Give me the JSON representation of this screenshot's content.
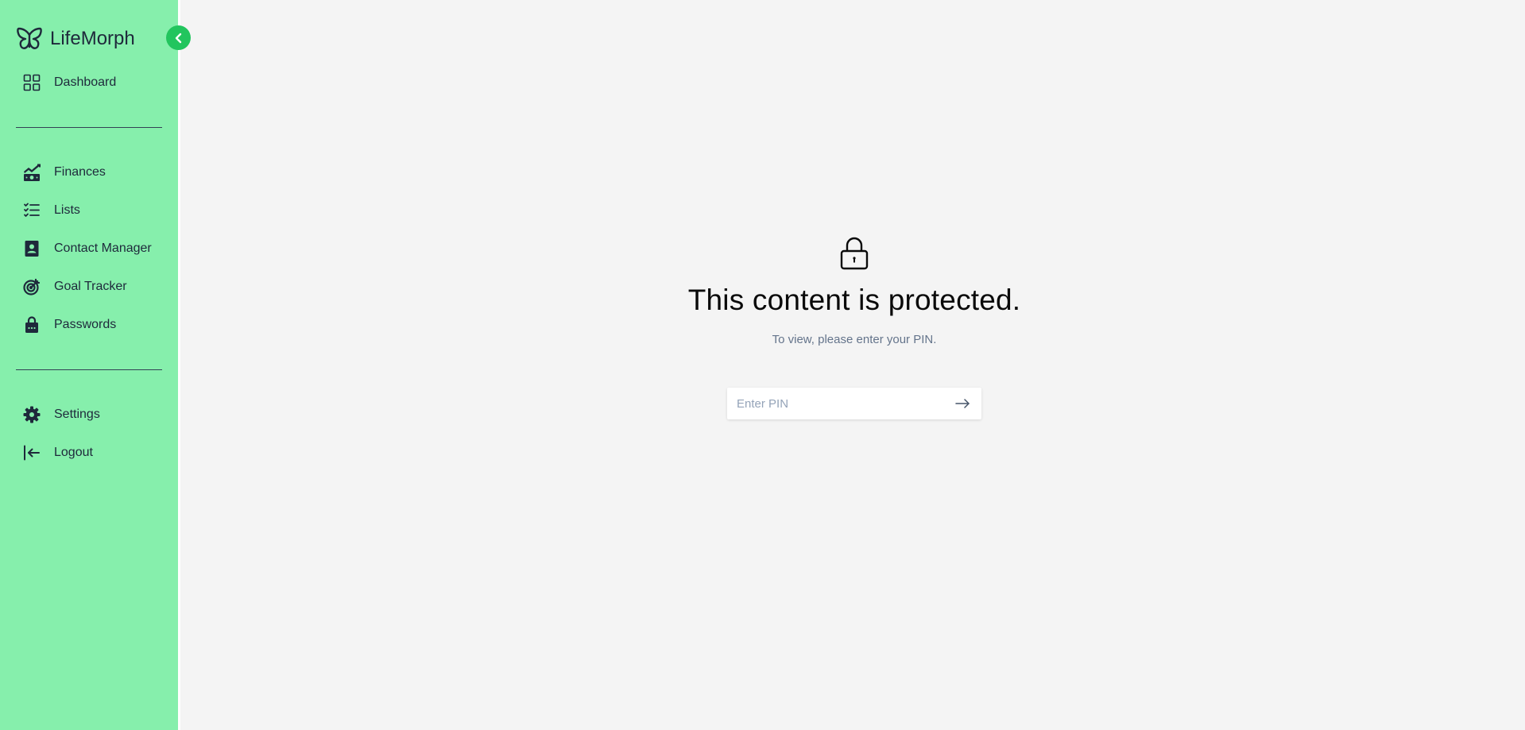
{
  "app": {
    "name": "LifeMorph"
  },
  "sidebar": {
    "primary": [
      {
        "label": "Dashboard",
        "icon": "grid-icon"
      }
    ],
    "modules": [
      {
        "label": "Finances",
        "icon": "finances-icon"
      },
      {
        "label": "Lists",
        "icon": "list-icon"
      },
      {
        "label": "Contact Manager",
        "icon": "contact-icon"
      },
      {
        "label": "Goal Tracker",
        "icon": "target-icon"
      },
      {
        "label": "Passwords",
        "icon": "lock-bag-icon"
      }
    ],
    "footer": [
      {
        "label": "Settings",
        "icon": "gear-icon"
      },
      {
        "label": "Logout",
        "icon": "logout-icon"
      }
    ]
  },
  "protected": {
    "title": "This content is protected.",
    "subtitle": "To view, please enter your PIN.",
    "pin_placeholder": "Enter PIN"
  },
  "colors": {
    "sidebar": "#86efac",
    "accent": "#22c55e",
    "background": "#f4f4f4",
    "text": "#1e293b"
  }
}
